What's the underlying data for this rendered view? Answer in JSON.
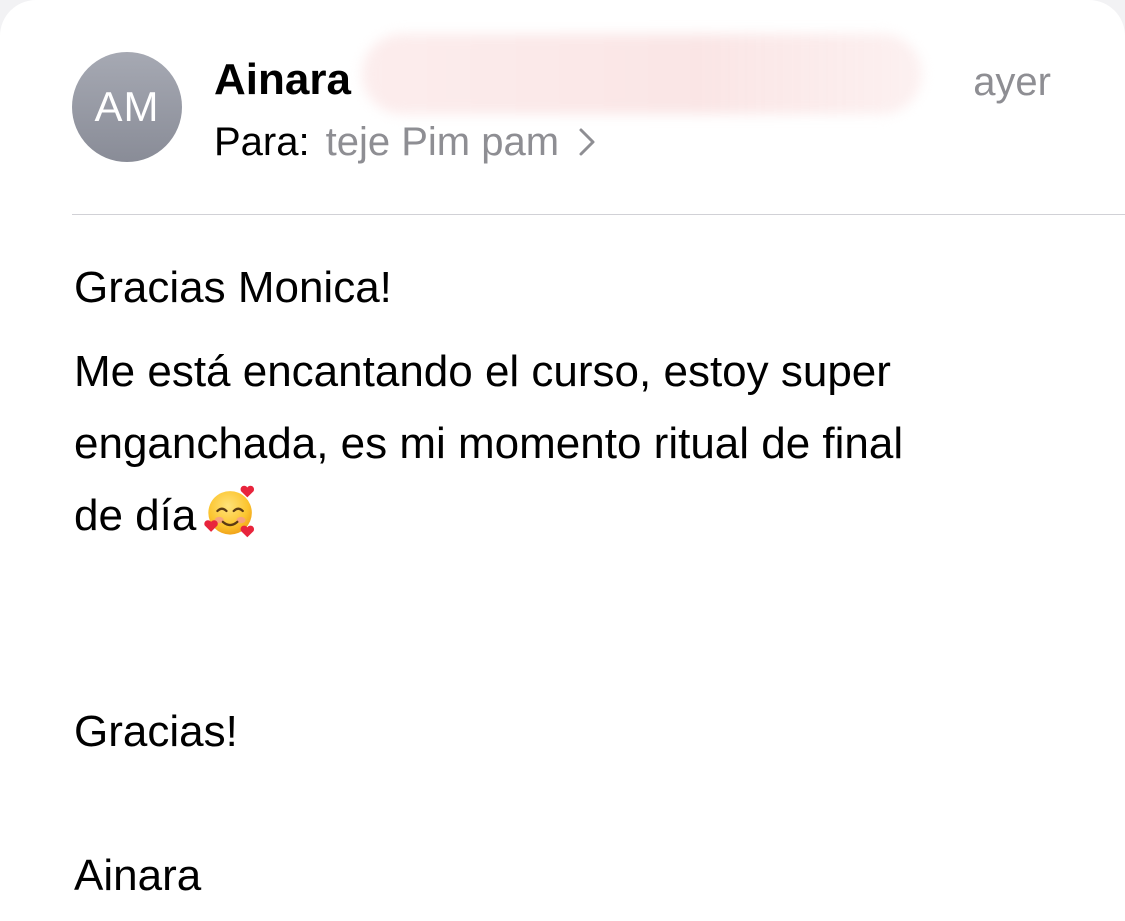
{
  "header": {
    "avatar_initials": "AM",
    "sender_name": "Ainara",
    "date": "ayer",
    "to_label": "Para:",
    "recipient": "teje Pim pam"
  },
  "message": {
    "greeting": "Gracias Monica!",
    "paragraph_line1": "Me está encantando el curso, estoy super",
    "paragraph_line2": "enganchada, es mi momento ritual de final",
    "paragraph_line3": "de día",
    "emoji": "smiling-face-with-hearts",
    "closing": "Gracias!",
    "signature": "Ainara"
  },
  "colors": {
    "avatar_bg": "#9a9da7",
    "secondary_text": "#8e8e93",
    "divider": "#d1d1d6"
  }
}
